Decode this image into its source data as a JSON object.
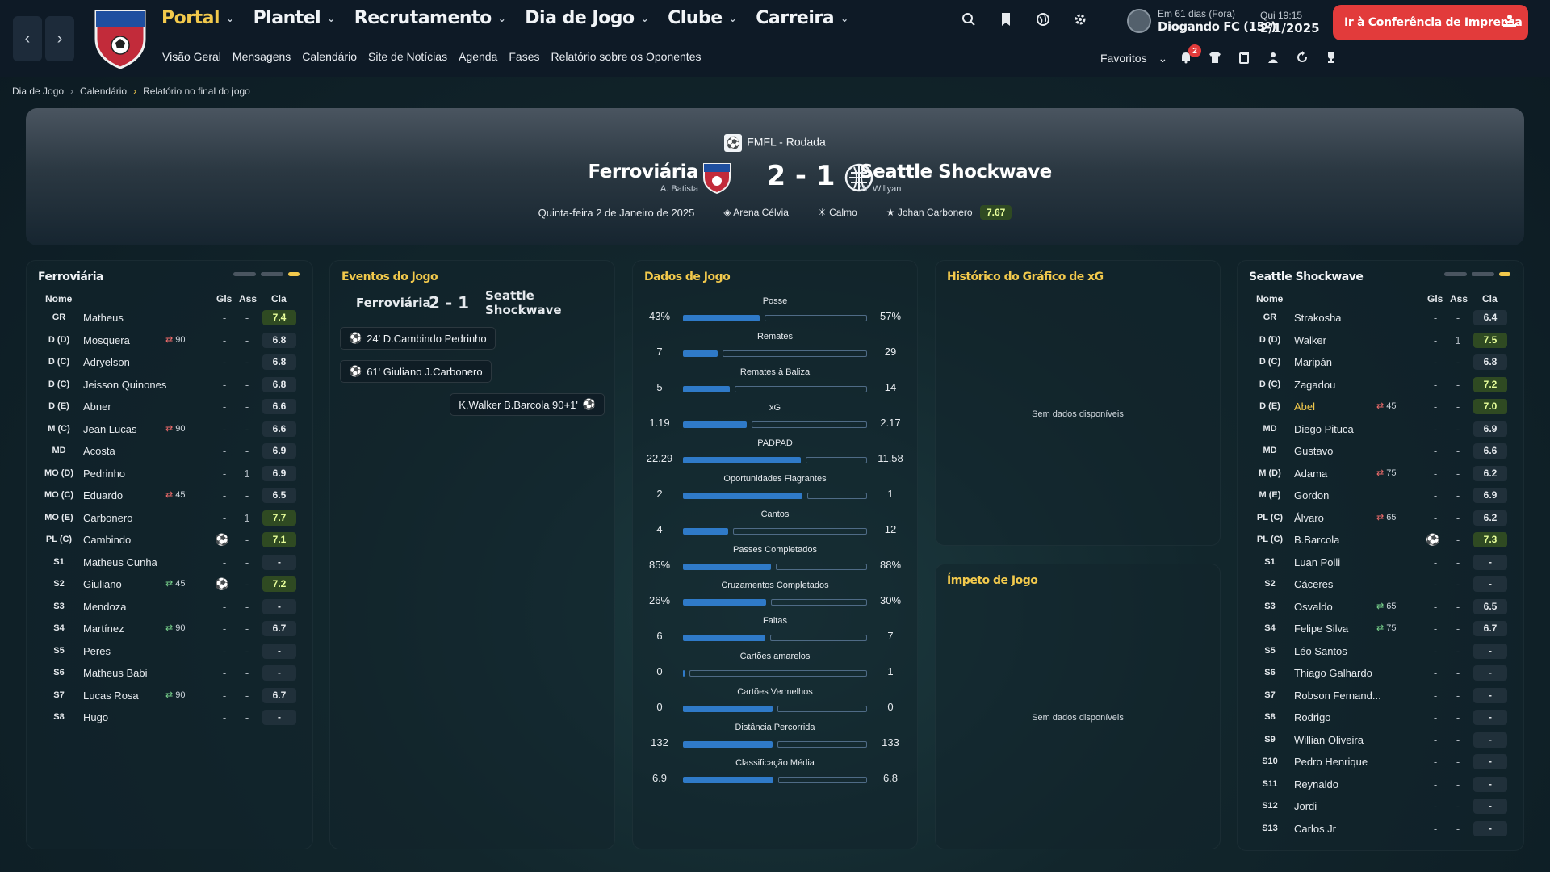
{
  "nav": {
    "back_icon": "chevron-left-icon",
    "forward_icon": "chevron-right-icon",
    "main": [
      {
        "label": "Portal",
        "active": true
      },
      {
        "label": "Plantel"
      },
      {
        "label": "Recrutamento"
      },
      {
        "label": "Dia de Jogo"
      },
      {
        "label": "Clube"
      },
      {
        "label": "Carreira"
      }
    ],
    "sub": [
      "Visão Geral",
      "Mensagens",
      "Calendário",
      "Site de Notícias",
      "Agenda",
      "Fases",
      "Relatório sobre os Oponentes"
    ],
    "manager": {
      "line1": "Em 61 dias (Fora)",
      "line2": "Diogando FC (15º)"
    },
    "date": {
      "line1": "Qui  19:15",
      "line2": "2/1/2025"
    },
    "press_button": "Ir à Conferência de Imprensa",
    "favorites": "Favoritos",
    "inbox_badge": "2"
  },
  "breadcrumb": [
    "Dia de Jogo",
    "Calendário",
    "Relatório no final do jogo"
  ],
  "match": {
    "competition": "FMFL - Rodada",
    "home": {
      "name": "Ferroviária",
      "manager": "A. Batista"
    },
    "away": {
      "name": "Seattle Shockwave",
      "manager": "W. Willyan"
    },
    "score": "2 - 1",
    "date": "Quinta-feira 2 de Janeiro de 2025",
    "stadium": "Arena Célvia",
    "weather": "Calmo",
    "player_of_match": "Johan Carbonero",
    "pom_rating": "7.67"
  },
  "home_panel": {
    "title": "Ferroviária",
    "headers": {
      "name": "Nome",
      "goals": "Gls",
      "assists": "Ass",
      "rating": "Cla"
    },
    "players": [
      {
        "pos": "GR",
        "name": "Matheus",
        "sub": "",
        "gls": "-",
        "ass": "-",
        "rating": "7.4",
        "ball": false
      },
      {
        "pos": "D (D)",
        "name": "Mosquera",
        "sub": "90'",
        "subtype": "off",
        "gls": "-",
        "ass": "-",
        "rating": "6.8"
      },
      {
        "pos": "D (C)",
        "name": "Adryelson",
        "sub": "",
        "gls": "-",
        "ass": "-",
        "rating": "6.8"
      },
      {
        "pos": "D (C)",
        "name": "Jeisson Quinones",
        "sub": "",
        "gls": "-",
        "ass": "-",
        "rating": "6.8"
      },
      {
        "pos": "D (E)",
        "name": "Abner",
        "sub": "",
        "gls": "-",
        "ass": "-",
        "rating": "6.6"
      },
      {
        "pos": "M (C)",
        "name": "Jean Lucas",
        "sub": "90'",
        "subtype": "off",
        "gls": "-",
        "ass": "-",
        "rating": "6.6"
      },
      {
        "pos": "MD",
        "name": "Acosta",
        "sub": "",
        "gls": "-",
        "ass": "-",
        "rating": "6.9"
      },
      {
        "pos": "MO (D)",
        "name": "Pedrinho",
        "sub": "",
        "gls": "-",
        "ass": "1",
        "rating": "6.9"
      },
      {
        "pos": "MO (C)",
        "name": "Eduardo",
        "sub": "45'",
        "subtype": "off",
        "gls": "-",
        "ass": "-",
        "rating": "6.5"
      },
      {
        "pos": "MO (E)",
        "name": "Carbonero",
        "sub": "",
        "gls": "-",
        "ass": "1",
        "rating": "7.7"
      },
      {
        "pos": "PL (C)",
        "name": "Cambindo",
        "sub": "",
        "gls": "ball",
        "ass": "-",
        "rating": "7.1"
      },
      {
        "pos": "S1",
        "name": "Matheus Cunha",
        "sub": "",
        "gls": "-",
        "ass": "-",
        "rating": "-"
      },
      {
        "pos": "S2",
        "name": "Giuliano",
        "sub": "45'",
        "subtype": "on",
        "gls": "ball",
        "ass": "-",
        "rating": "7.2"
      },
      {
        "pos": "S3",
        "name": "Mendoza",
        "sub": "",
        "gls": "-",
        "ass": "-",
        "rating": "-"
      },
      {
        "pos": "S4",
        "name": "Martínez",
        "sub": "90'",
        "subtype": "on",
        "gls": "-",
        "ass": "-",
        "rating": "6.7"
      },
      {
        "pos": "S5",
        "name": "Peres",
        "sub": "",
        "gls": "-",
        "ass": "-",
        "rating": "-"
      },
      {
        "pos": "S6",
        "name": "Matheus Babi",
        "sub": "",
        "gls": "-",
        "ass": "-",
        "rating": "-"
      },
      {
        "pos": "S7",
        "name": "Lucas Rosa",
        "sub": "90'",
        "subtype": "on",
        "gls": "-",
        "ass": "-",
        "rating": "6.7"
      },
      {
        "pos": "S8",
        "name": "Hugo",
        "sub": "",
        "gls": "-",
        "ass": "-",
        "rating": "-"
      }
    ]
  },
  "away_panel": {
    "title": "Seattle Shockwave",
    "headers": {
      "name": "Nome",
      "goals": "Gls",
      "assists": "Ass",
      "rating": "Cla"
    },
    "players": [
      {
        "pos": "GR",
        "name": "Strakosha",
        "sub": "",
        "gls": "-",
        "ass": "-",
        "rating": "6.4"
      },
      {
        "pos": "D (D)",
        "name": "Walker",
        "sub": "",
        "gls": "-",
        "ass": "1",
        "rating": "7.5"
      },
      {
        "pos": "D (C)",
        "name": "Maripán",
        "sub": "",
        "gls": "-",
        "ass": "-",
        "rating": "6.8"
      },
      {
        "pos": "D (C)",
        "name": "Zagadou",
        "sub": "",
        "gls": "-",
        "ass": "-",
        "rating": "7.2"
      },
      {
        "pos": "D (E)",
        "name": "Abel",
        "sub": "45'",
        "subtype": "off",
        "gls": "-",
        "ass": "-",
        "rating": "7.0",
        "highlight": true
      },
      {
        "pos": "MD",
        "name": "Diego Pituca",
        "sub": "",
        "gls": "-",
        "ass": "-",
        "rating": "6.9"
      },
      {
        "pos": "MD",
        "name": "Gustavo",
        "sub": "",
        "gls": "-",
        "ass": "-",
        "rating": "6.6"
      },
      {
        "pos": "M (D)",
        "name": "Adama",
        "sub": "75'",
        "subtype": "off",
        "gls": "-",
        "ass": "-",
        "rating": "6.2"
      },
      {
        "pos": "M (E)",
        "name": "Gordon",
        "sub": "",
        "gls": "-",
        "ass": "-",
        "rating": "6.9"
      },
      {
        "pos": "PL (C)",
        "name": "Álvaro",
        "sub": "65'",
        "subtype": "off",
        "gls": "-",
        "ass": "-",
        "rating": "6.2"
      },
      {
        "pos": "PL (C)",
        "name": "B.Barcola",
        "sub": "",
        "gls": "ball",
        "ass": "-",
        "rating": "7.3"
      },
      {
        "pos": "S1",
        "name": "Luan Polli",
        "sub": "",
        "gls": "-",
        "ass": "-",
        "rating": "-"
      },
      {
        "pos": "S2",
        "name": "Cáceres",
        "sub": "",
        "gls": "-",
        "ass": "-",
        "rating": "-"
      },
      {
        "pos": "S3",
        "name": "Osvaldo",
        "sub": "65'",
        "subtype": "on",
        "gls": "-",
        "ass": "-",
        "rating": "6.5"
      },
      {
        "pos": "S4",
        "name": "Felipe Silva",
        "sub": "75'",
        "subtype": "on",
        "gls": "-",
        "ass": "-",
        "rating": "6.7"
      },
      {
        "pos": "S5",
        "name": "Léo Santos",
        "sub": "",
        "gls": "-",
        "ass": "-",
        "rating": "-"
      },
      {
        "pos": "S6",
        "name": "Thiago Galhardo",
        "sub": "",
        "gls": "-",
        "ass": "-",
        "rating": "-"
      },
      {
        "pos": "S7",
        "name": "Robson Fernand...",
        "sub": "",
        "gls": "-",
        "ass": "-",
        "rating": "-"
      },
      {
        "pos": "S8",
        "name": "Rodrigo",
        "sub": "",
        "gls": "-",
        "ass": "-",
        "rating": "-"
      },
      {
        "pos": "S9",
        "name": "Willian Oliveira",
        "sub": "",
        "gls": "-",
        "ass": "-",
        "rating": "-"
      },
      {
        "pos": "S10",
        "name": "Pedro Henrique",
        "sub": "",
        "gls": "-",
        "ass": "-",
        "rating": "-"
      },
      {
        "pos": "S11",
        "name": "Reynaldo",
        "sub": "",
        "gls": "-",
        "ass": "-",
        "rating": "-"
      },
      {
        "pos": "S12",
        "name": "Jordi",
        "sub": "",
        "gls": "-",
        "ass": "-",
        "rating": "-"
      },
      {
        "pos": "S13",
        "name": "Carlos Jr",
        "sub": "",
        "gls": "-",
        "ass": "-",
        "rating": "-"
      }
    ]
  },
  "events": {
    "title": "Eventos do Jogo",
    "home": "Ferroviária",
    "score": "2 - 1",
    "away": "Seattle Shockwave",
    "items": [
      {
        "side": "home",
        "text": "24'  D.Cambindo  Pedrinho"
      },
      {
        "side": "home",
        "text": "61'  Giuliano  J.Carbonero"
      },
      {
        "side": "away",
        "text": "K.Walker  B.Barcola  90+1'"
      }
    ]
  },
  "stats": {
    "title": "Dados de Jogo",
    "rows": [
      {
        "label": "Posse",
        "home": "43%",
        "away": "57%",
        "hv": 43,
        "av": 57
      },
      {
        "label": "Remates",
        "home": "7",
        "away": "29",
        "hv": 7,
        "av": 29
      },
      {
        "label": "Remates à Baliza",
        "home": "5",
        "away": "14",
        "hv": 5,
        "av": 14
      },
      {
        "label": "xG",
        "home": "1.19",
        "away": "2.17",
        "hv": 1.19,
        "av": 2.17
      },
      {
        "label": "PADPAD",
        "home": "22.29",
        "away": "11.58",
        "hv": 22.29,
        "av": 11.58
      },
      {
        "label": "Oportunidades Flagrantes",
        "home": "2",
        "away": "1",
        "hv": 2,
        "av": 1
      },
      {
        "label": "Cantos",
        "home": "4",
        "away": "12",
        "hv": 4,
        "av": 12
      },
      {
        "label": "Passes Completados",
        "home": "85%",
        "away": "88%",
        "hv": 85,
        "av": 88
      },
      {
        "label": "Cruzamentos Completados",
        "home": "26%",
        "away": "30%",
        "hv": 26,
        "av": 30
      },
      {
        "label": "Faltas",
        "home": "6",
        "away": "7",
        "hv": 6,
        "av": 7
      },
      {
        "label": "Cartões amarelos",
        "home": "0",
        "away": "1",
        "hv": 0,
        "av": 1
      },
      {
        "label": "Cartões Vermelhos",
        "home": "0",
        "away": "0",
        "hv": 0,
        "av": 0
      },
      {
        "label": "Distância Percorrida",
        "home": "132",
        "away": "133",
        "hv": 132,
        "av": 133
      },
      {
        "label": "Classificação Média",
        "home": "6.9",
        "away": "6.8",
        "hv": 6.9,
        "av": 6.8
      }
    ]
  },
  "xg_panel": {
    "title": "Histórico do Gráfico de xG",
    "empty": "Sem dados disponíveis"
  },
  "momentum_panel": {
    "title": "Ímpeto de Jogo",
    "empty": "Sem dados disponíveis"
  },
  "colors": {
    "accent": "#f2c94c",
    "press": "#e23b3b",
    "bar": "#2f7ac8"
  }
}
